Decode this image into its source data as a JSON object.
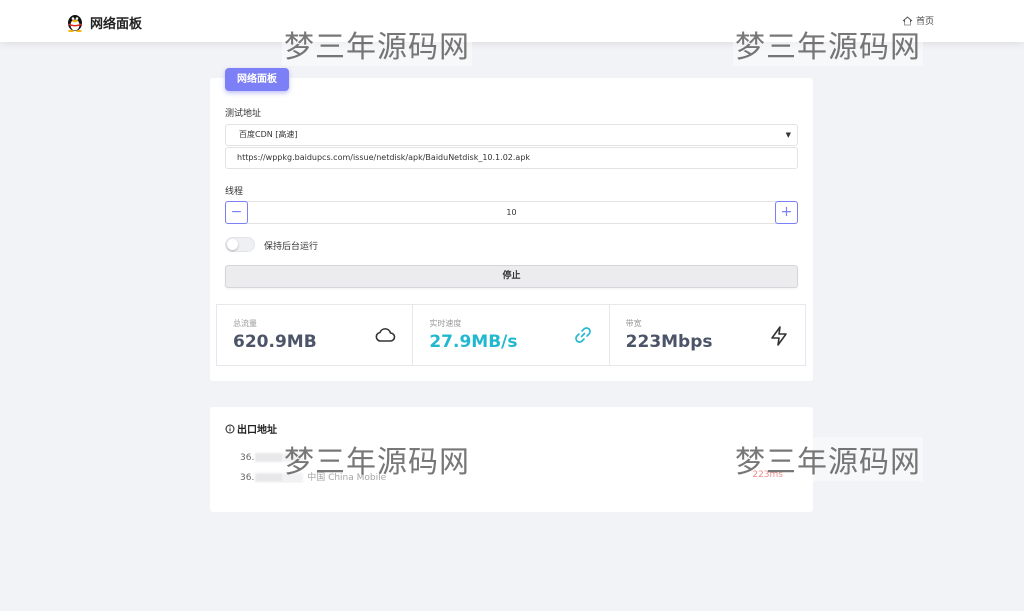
{
  "header": {
    "title": "网络面板",
    "home_label": "首页"
  },
  "watermark": "梦三年源码网",
  "panel": {
    "badge": "网络面板",
    "test_addr_label": "测试地址",
    "source_selected": "百度CDN [高速]",
    "url_value": "https://wppkg.baidupcs.com/issue/netdisk/apk/BaiduNetdisk_10.1.02.apk",
    "threads_label": "线程",
    "threads_value": "10",
    "stepper_minus": "−",
    "stepper_plus": "+",
    "bg_toggle_label": "保持后台运行",
    "bg_toggle_on": false,
    "stop_label": "停止"
  },
  "stats": [
    {
      "label": "总流量",
      "value": "620.9MB",
      "icon": "cloud-icon"
    },
    {
      "label": "实时速度",
      "value": "27.9MB/s",
      "icon": "link-icon"
    },
    {
      "label": "带宽",
      "value": "223Mbps",
      "icon": "lightning-icon"
    }
  ],
  "exit": {
    "title": "出口地址",
    "rows": [
      {
        "ip_prefix": "36.",
        "isp": "",
        "latency": ""
      },
      {
        "ip_prefix": "36.",
        "isp": "中国 China Mobile",
        "latency": "223ms"
      }
    ]
  },
  "colors": {
    "accent": "#7c7ff5",
    "speed": "#22b8cf",
    "latency": "#e03c3c",
    "stat_value": "#4b5468"
  }
}
